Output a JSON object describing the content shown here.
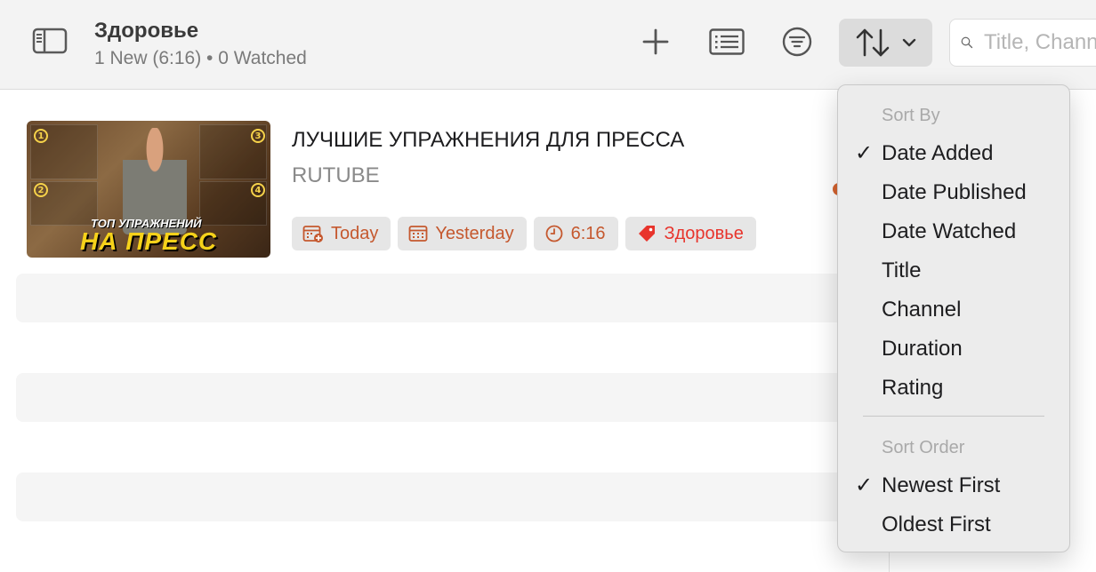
{
  "toolbar": {
    "title": "Здоровье",
    "subtitle": "1 New (6:16) • 0 Watched",
    "search_placeholder": "Title, Channel"
  },
  "video": {
    "title": "ЛУЧШИЕ УПРАЖНЕНИЯ ДЛЯ ПРЕССА",
    "channel": "RUTUBE",
    "thumbnail": {
      "caption_top": "ТОП УПРАЖНЕНИЙ",
      "caption_main": "НА ПРЕСС",
      "numbers": [
        "1",
        "2",
        "3",
        "4"
      ]
    },
    "tags": [
      {
        "label": "Today",
        "icon": "calendar-added-icon"
      },
      {
        "label": "Yesterday",
        "icon": "calendar-icon"
      },
      {
        "label": "6:16",
        "icon": "clock-icon"
      },
      {
        "label": "Здоровье",
        "icon": "tag-icon"
      }
    ]
  },
  "sort_menu": {
    "sort_by_header": "Sort By",
    "sort_by_items": [
      {
        "label": "Date Added",
        "checked": true
      },
      {
        "label": "Date Published",
        "checked": false
      },
      {
        "label": "Date Watched",
        "checked": false
      },
      {
        "label": "Title",
        "checked": false
      },
      {
        "label": "Channel",
        "checked": false
      },
      {
        "label": "Duration",
        "checked": false
      },
      {
        "label": "Rating",
        "checked": false
      }
    ],
    "sort_order_header": "Sort Order",
    "sort_order_items": [
      {
        "label": "Newest First",
        "checked": true
      },
      {
        "label": "Oldest First",
        "checked": false
      }
    ],
    "check_glyph": "✓"
  },
  "colors": {
    "accent_orange": "#c5582e",
    "tag_red": "#e8342c",
    "unread_dot": "#d5632f"
  }
}
